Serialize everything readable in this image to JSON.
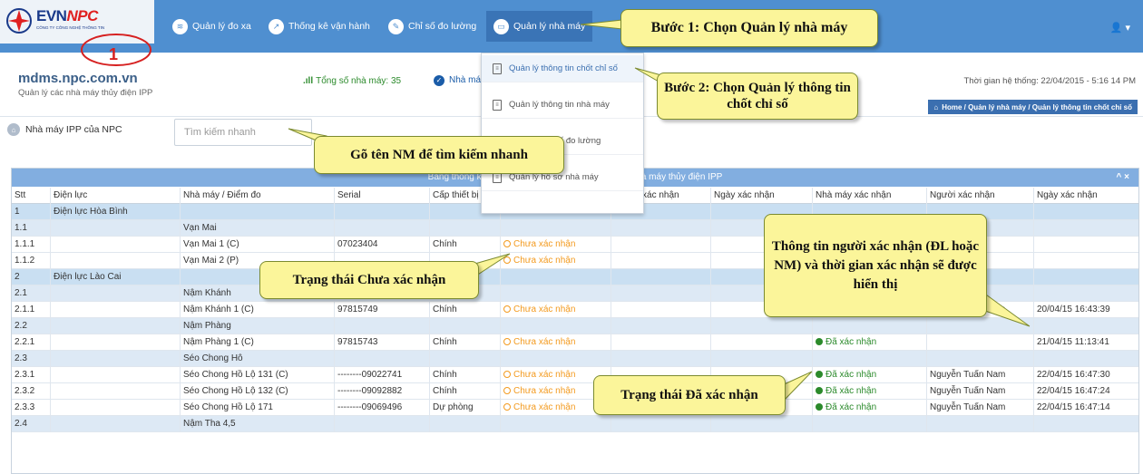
{
  "brand": {
    "logo_main": "EVN",
    "logo_accent": "NPC",
    "logo_sub": "CÔNG TY CÔNG NGHỆ THÔNG TIN"
  },
  "nav": {
    "items": [
      {
        "label": "Quản lý đo xa",
        "icon": "wifi-icon"
      },
      {
        "label": "Thống kê vận hành",
        "icon": "chart-line-icon"
      },
      {
        "label": "Chỉ số đo lường",
        "icon": "edit-icon"
      },
      {
        "label": "Quản lý nhà máy",
        "icon": "folder-icon"
      }
    ],
    "user_icon": "user-icon"
  },
  "site": {
    "title": "mdms.npc.com.vn",
    "subtitle": "Quản lý các nhà máy thủy điện IPP"
  },
  "stats": {
    "total_label": "Tổng số nhà máy: 35",
    "second_label": "Nhà má"
  },
  "system_time": "Thời gian hệ thống: 22/04/2015 - 5:16 14 PM",
  "breadcrumb": "Home / Quản lý nhà máy / Quản lý thông tin chốt chỉ số",
  "section": {
    "title": "Nhà máy IPP của NPC",
    "search_placeholder": "Tìm kiếm nhanh"
  },
  "dropdown": {
    "items": [
      {
        "label": "Quản lý thông tin chốt chỉ số"
      },
      {
        "label": "Quản lý thông tin nhà máy"
      },
      {
        "label": "Quản lý chỉ số đo lường"
      },
      {
        "label": "Quản lý hồ sơ nhà máy"
      }
    ]
  },
  "table": {
    "title": "Bảng thống kê hiện trạng xác nhận chỉ số của các nhà máy thủy điện IPP",
    "header_controls": "^ ×",
    "columns": [
      "Stt",
      "Điện lực",
      "Nhà máy / Điểm đo",
      "Serial",
      "Cấp thiết bị",
      "Trạng thái",
      "Người xác nhận",
      "Ngày xác nhận",
      "Nhà máy xác nhận",
      "Người xác nhận",
      "Ngày xác nhận"
    ],
    "rows": [
      {
        "kind": "group",
        "cells": [
          "1",
          "Điện lực Hòa Bình",
          "",
          "",
          "",
          "",
          "",
          "",
          "",
          "",
          ""
        ]
      },
      {
        "kind": "sub",
        "cells": [
          "1.1",
          "",
          "Vạn Mai",
          "",
          "",
          "",
          "",
          "",
          "",
          "",
          ""
        ]
      },
      {
        "kind": "data",
        "cells": [
          "1.1.1",
          "",
          "Vạn Mai 1 (C)",
          "07023404",
          "Chính",
          "Chưa xác nhận",
          "",
          "",
          "",
          "",
          ""
        ]
      },
      {
        "kind": "data",
        "cells": [
          "1.1.2",
          "",
          "Vạn Mai 2 (P)",
          "",
          "",
          "Chưa xác nhận",
          "",
          "",
          "",
          "",
          ""
        ]
      },
      {
        "kind": "group",
        "cells": [
          "2",
          "Điện lực Lào Cai",
          "",
          "",
          "",
          "",
          "",
          "",
          "",
          "",
          ""
        ]
      },
      {
        "kind": "sub",
        "cells": [
          "2.1",
          "",
          "Nậm Khánh",
          "",
          "",
          "",
          "",
          "",
          "",
          "",
          ""
        ]
      },
      {
        "kind": "data",
        "cells": [
          "2.1.1",
          "",
          "Nậm Khánh 1 (C)",
          "97815749",
          "Chính",
          "Chưa xác nhận",
          "",
          "",
          "Đã xác nhận",
          "Nguyễn Tuấn Nam",
          "20/04/15 16:43:39"
        ]
      },
      {
        "kind": "sub",
        "cells": [
          "2.2",
          "",
          "Nậm Phàng",
          "",
          "",
          "",
          "",
          "",
          "",
          "",
          ""
        ]
      },
      {
        "kind": "data",
        "cells": [
          "2.2.1",
          "",
          "Nậm Phàng 1 (C)",
          "97815743",
          "Chính",
          "Chưa xác nhận",
          "",
          "",
          "Đã xác nhận",
          "",
          "21/04/15 11:13:41"
        ]
      },
      {
        "kind": "sub",
        "cells": [
          "2.3",
          "",
          "Séo Chong Hô",
          "",
          "",
          "",
          "",
          "",
          "",
          "",
          ""
        ]
      },
      {
        "kind": "data",
        "cells": [
          "2.3.1",
          "",
          "Séo Chong Hồ Lộ 131 (C)",
          "--------09022741",
          "Chính",
          "Chưa xác nhận",
          "",
          "",
          "Đã xác nhận",
          "Nguyễn Tuấn Nam",
          "22/04/15 16:47:30"
        ]
      },
      {
        "kind": "data",
        "cells": [
          "2.3.2",
          "",
          "Séo Chong Hồ Lộ 132 (C)",
          "--------09092882",
          "Chính",
          "Chưa xác nhận",
          "",
          "",
          "Đã xác nhận",
          "Nguyễn Tuấn Nam",
          "22/04/15 16:47:24"
        ]
      },
      {
        "kind": "data",
        "cells": [
          "2.3.3",
          "",
          "Séo Chong Hồ Lộ 171",
          "--------09069496",
          "Dự phòng",
          "Chưa xác nhận",
          "",
          "",
          "Đã xác nhận",
          "Nguyễn Tuấn Nam",
          "22/04/15 16:47:14"
        ]
      },
      {
        "kind": "sub",
        "cells": [
          "2.4",
          "",
          "Nậm Tha 4,5",
          "",
          "",
          "",
          "",
          "",
          "",
          "",
          ""
        ]
      }
    ]
  },
  "callouts": {
    "step_number": "1",
    "step1": "Bước 1: Chọn Quản lý nhà máy",
    "step2": "Bước 2: Chọn Quản lý thông tin chốt chỉ số",
    "search_hint": "Gõ tên NM để tìm kiếm nhanh",
    "pending": "Trạng thái Chưa xác nhận",
    "confirmer_info": "Thông tin người xác nhận (ĐL hoặc NM) và thời gian xác nhận sẽ được hiển thị",
    "confirmed": "Trạng thái Đã xác nhận"
  }
}
